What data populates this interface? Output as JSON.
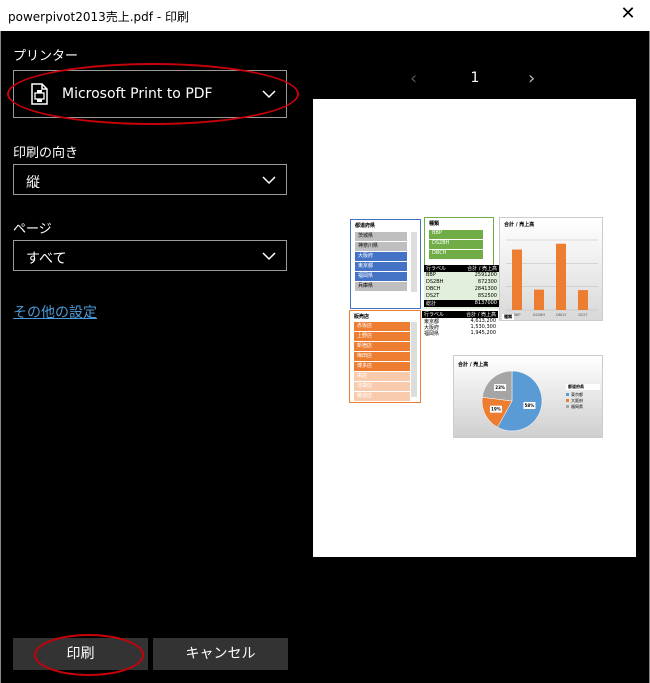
{
  "window": {
    "title": "powerpivot2013売上.pdf - 印刷",
    "close_glyph": "✕"
  },
  "printer": {
    "label": "プリンター",
    "value": "Microsoft Print to PDF"
  },
  "orientation": {
    "label": "印刷の向き",
    "value": "縦"
  },
  "pages": {
    "label": "ページ",
    "value": "すべて"
  },
  "more_settings": "その他の設定",
  "buttons": {
    "print": "印刷",
    "cancel": "キャンセル"
  },
  "pager": {
    "prev": "‹",
    "current": "1",
    "next": "›"
  },
  "preview": {
    "slicer1": {
      "title": "都道府県",
      "items": [
        "茨城県",
        "神奈川県",
        "大阪府",
        "東京都",
        "福岡県",
        "兵庫県"
      ]
    },
    "slicer2": {
      "title": "種類",
      "items": [
        "BBP",
        "DS2BH",
        "DBCH"
      ]
    },
    "pivot": {
      "header": [
        "行ラベル",
        "合計 / 売上高"
      ],
      "rows": [
        [
          "BBP",
          "2591200"
        ],
        [
          "DS2BH",
          "872300"
        ],
        [
          "DBCH",
          "2841300"
        ],
        [
          "DS2T",
          "852500"
        ]
      ],
      "total": [
        "総計",
        "8137000"
      ]
    },
    "slicer3": {
      "title": "販売店",
      "items": [
        "赤坂店",
        "上野店",
        "新宿店",
        "梅田店",
        "博多店",
        "栄店",
        "池袋店",
        "難波店"
      ]
    },
    "pivot2": {
      "header": [
        "行ラベル",
        "合計 / 売上高"
      ],
      "rows": [
        [
          "東京都",
          "4,613,200"
        ],
        [
          "大阪府",
          "1,530,300"
        ],
        [
          "福岡県",
          "1,945,200"
        ]
      ]
    },
    "bar_chart": {
      "title": "合計 / 売上高",
      "categories": [
        "BBP",
        "DS2BH",
        "DBCH",
        "DS2T"
      ],
      "values": [
        2591200,
        872300,
        2841300,
        852500
      ],
      "filter": "種類"
    },
    "pie_chart": {
      "title": "合計 / 売上高",
      "legend_title": "都道府県",
      "legend": [
        "東京都",
        "大阪府",
        "福岡県"
      ],
      "labels": [
        "58%",
        "19%",
        "23%"
      ],
      "colors": [
        "#5b9bd5",
        "#ed7d31",
        "#a5a5a5"
      ]
    }
  }
}
